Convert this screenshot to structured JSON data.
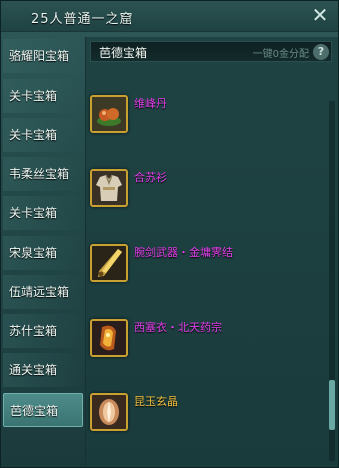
{
  "window": {
    "title": "25人普通一之窟"
  },
  "sidebar": {
    "items": [
      {
        "label": "骆耀阳宝箱",
        "active": false
      },
      {
        "label": "关卡宝箱",
        "active": false
      },
      {
        "label": "关卡宝箱",
        "active": false
      },
      {
        "label": "韦柔丝宝箱",
        "active": false
      },
      {
        "label": "关卡宝箱",
        "active": false
      },
      {
        "label": "宋泉宝箱",
        "active": false
      },
      {
        "label": "伍靖远宝箱",
        "active": false
      },
      {
        "label": "苏什宝箱",
        "active": false
      },
      {
        "label": "通关宝箱",
        "active": false
      },
      {
        "label": "芭德宝箱",
        "active": true
      }
    ]
  },
  "panel": {
    "title": "芭德宝箱",
    "hint": "一键0金分配",
    "help_label": "?"
  },
  "items": [
    {
      "name": "维峰丹",
      "quality": "purple",
      "icon": "pill-icon"
    },
    {
      "name": "合苏衫",
      "quality": "purple",
      "icon": "robe-icon"
    },
    {
      "name": "腕剑武器・金墉霁结",
      "quality": "purple",
      "icon": "blade-icon"
    },
    {
      "name": "西塞衣・北天药宗",
      "quality": "purple",
      "icon": "gem-icon"
    },
    {
      "name": "昆玉玄晶",
      "quality": "gold",
      "icon": "crystal-icon"
    }
  ],
  "scroll": {
    "position": 0.9
  },
  "colors": {
    "purple_quality": "#e23ee8",
    "gold_quality": "#f0c040",
    "slot_border": "#c9a032"
  }
}
